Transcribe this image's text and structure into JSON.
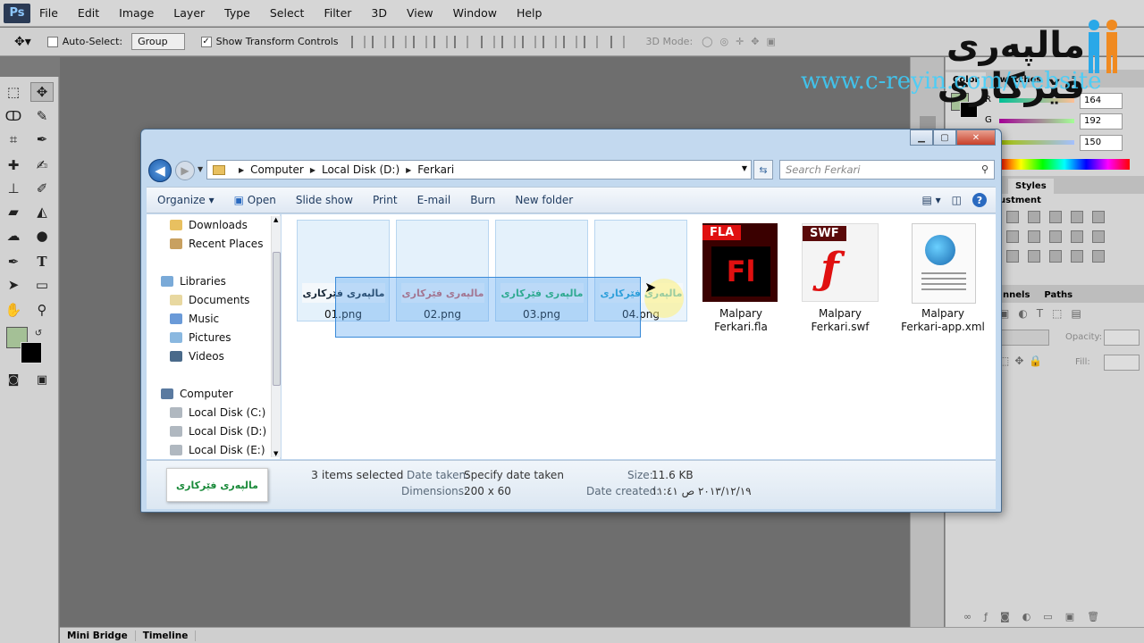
{
  "photoshop": {
    "logo": "Ps",
    "menu": [
      "File",
      "Edit",
      "Image",
      "Layer",
      "Type",
      "Select",
      "Filter",
      "3D",
      "View",
      "Window",
      "Help"
    ],
    "options": {
      "auto_select_label": "Auto-Select:",
      "group_value": "Group",
      "transform_label": "Show Transform Controls",
      "mode_3d_label": "3D Mode:"
    },
    "bottom_tabs": [
      "Mini Bridge",
      "Timeline"
    ],
    "color_panel": {
      "tabs": [
        "Color",
        "Swatches"
      ],
      "r_label": "R",
      "g_label": "G",
      "r": "164",
      "g": "192",
      "b": "150"
    },
    "styles_panel": {
      "tabs": [
        "Styles"
      ],
      "adjust_label": "ustment"
    },
    "layers_panel": {
      "tabs": [
        "nnels",
        "Paths"
      ],
      "opacity_label": "Opacity:",
      "fill_label": "Fill:"
    },
    "foreground_color": "#a4c096"
  },
  "watermark": {
    "title": "مالپەری فێرکاری",
    "url": "www.c-reyin.com/website"
  },
  "explorer": {
    "breadcrumb": [
      "Computer",
      "Local Disk (D:)",
      "Ferkari"
    ],
    "search_placeholder": "Search Ferkari",
    "commands": [
      "Organize",
      "Open",
      "Slide show",
      "Print",
      "E-mail",
      "Burn",
      "New folder"
    ],
    "nav": [
      {
        "label": "Downloads"
      },
      {
        "label": "Recent Places"
      },
      {
        "label": "Libraries"
      },
      {
        "label": "Documents"
      },
      {
        "label": "Music"
      },
      {
        "label": "Pictures"
      },
      {
        "label": "Videos"
      },
      {
        "label": "Computer"
      },
      {
        "label": "Local Disk (C:)"
      },
      {
        "label": "Local Disk (D:)"
      },
      {
        "label": "Local Disk (E:)"
      }
    ],
    "files": [
      {
        "name": "01.png",
        "thumb_text": "مالپەری فێرکاری",
        "color": "#1a2a3a"
      },
      {
        "name": "02.png",
        "thumb_text": "مالپەری فێرکاری",
        "color": "#d06060"
      },
      {
        "name": "03.png",
        "thumb_text": "مالپەری فێرکاری",
        "color": "#20b060"
      },
      {
        "name": "04.png",
        "thumb_text": "مالپەری فێرکاری",
        "color": "#20a0d0"
      },
      {
        "name": "Malpary Ferkari.fla",
        "line1": "Malpary",
        "line2": "Ferkari.fla",
        "badge": "FLA",
        "glyph": "Fl"
      },
      {
        "name": "Malpary Ferkari.swf",
        "line1": "Malpary",
        "line2": "Ferkari.swf",
        "badge": "SWF",
        "glyph": "ƒ"
      },
      {
        "name": "Malpary Ferkari-app.xml",
        "line1": "Malpary",
        "line2": "Ferkari-app.xml"
      }
    ],
    "details": {
      "thumb_text": "مالپەری فێرکاری",
      "selected": "3 items selected",
      "date_taken_label": "Date taken:",
      "date_taken": "Specify date taken",
      "dimensions_label": "Dimensions:",
      "dimensions": "200 x 60",
      "size_label": "Size:",
      "size": "11.6 KB",
      "date_created_label": "Date created:",
      "date_created": "٢٠١٣/١٢/١٩ ص ١١:٤١"
    }
  }
}
